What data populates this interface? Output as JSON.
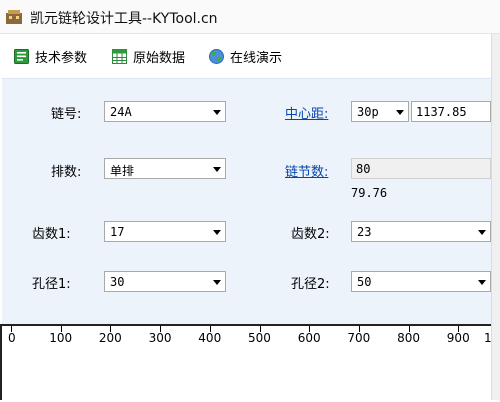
{
  "window": {
    "title": "凯元链轮设计工具--KYTool.cn"
  },
  "toolbar": {
    "tech_params": "技术参数",
    "raw_data": "原始数据",
    "online_demo": "在线演示"
  },
  "form": {
    "chain_no_label": "链号:",
    "chain_no_value": "24A",
    "rows_label": "排数:",
    "rows_value": "单排",
    "teeth1_label": "齿数1:",
    "teeth1_value": "17",
    "bore1_label": "孔径1:",
    "bore1_value": "30",
    "center_label": "中心距:",
    "center_unit_value": "30p",
    "center_value": "1137.85",
    "links_label": "链节数:",
    "links_value": "80",
    "links_note": "79.76",
    "teeth2_label": "齿数2:",
    "teeth2_value": "23",
    "bore2_label": "孔径2:",
    "bore2_value": "50"
  },
  "ruler": {
    "ticks": [
      "0",
      "100",
      "200",
      "300",
      "400",
      "500",
      "600",
      "700",
      "800",
      "900",
      "1"
    ]
  },
  "colors": {
    "panel_bg": "#edf3fb",
    "link": "#0645ad"
  }
}
